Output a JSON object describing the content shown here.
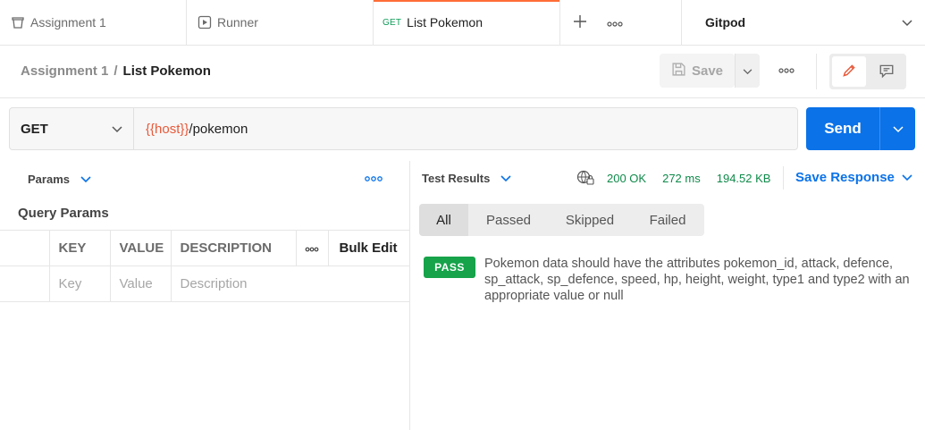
{
  "tabs": [
    {
      "label": "Assignment 1",
      "icon": "collection-icon"
    },
    {
      "label": "Runner",
      "icon": "play-icon"
    },
    {
      "method": "GET",
      "label": "List Pokemon",
      "active": true
    }
  ],
  "workspace": {
    "name": "Gitpod"
  },
  "breadcrumb": {
    "parent": "Assignment 1",
    "separator": "/",
    "current": "List Pokemon"
  },
  "toolbar": {
    "save_label": "Save"
  },
  "request": {
    "method": "GET",
    "url_variable": "{{host}}",
    "url_path": "/pokemon",
    "send_label": "Send"
  },
  "params": {
    "tab_label": "Params",
    "section_title": "Query Params",
    "columns": {
      "key": "KEY",
      "value": "VALUE",
      "description": "DESCRIPTION",
      "bulk_edit": "Bulk Edit"
    },
    "placeholders": {
      "key": "Key",
      "value": "Value",
      "description": "Description"
    }
  },
  "response": {
    "tab_label": "Test Results",
    "status": "200 OK",
    "time": "272 ms",
    "size": "194.52 KB",
    "save_response_label": "Save Response",
    "filters": [
      "All",
      "Passed",
      "Skipped",
      "Failed"
    ],
    "selected_filter": "All",
    "results": [
      {
        "badge": "PASS",
        "text": "Pokemon data should have the attributes pokemon_id, attack, defence, sp_attack, sp_defence, speed, hp, height, weight, type1 and type2 with an appropriate value or null"
      }
    ]
  },
  "colors": {
    "accent": "#ff6c37",
    "primary": "#0b72e8",
    "success": "#16a34a",
    "status": "#0f8a4a"
  }
}
